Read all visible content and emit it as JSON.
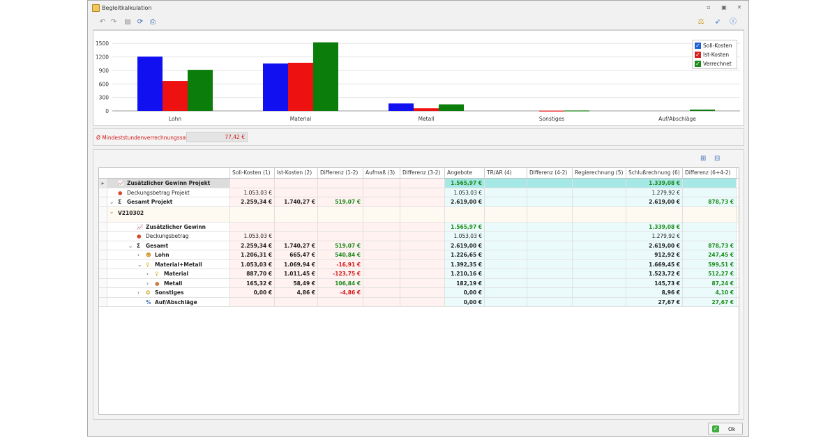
{
  "window": {
    "title": "Begleitkalkulation"
  },
  "legend": [
    {
      "label": "Soll-Kosten",
      "color": "#1010f0"
    },
    {
      "label": "Ist-Kosten",
      "color": "#ee1111"
    },
    {
      "label": "Verrechnet",
      "color": "#0b7d0b"
    }
  ],
  "chart_data": {
    "type": "bar",
    "categories": [
      "Lohn",
      "Material",
      "Metall",
      "Sonstiges",
      "Auf/Abschläge"
    ],
    "series": [
      {
        "name": "Soll-Kosten",
        "values": [
          1206.31,
          1053.03,
          165.32,
          0,
          0
        ]
      },
      {
        "name": "Ist-Kosten",
        "values": [
          665.47,
          1069.94,
          58.49,
          4.86,
          0
        ]
      },
      {
        "name": "Verrechnet",
        "values": [
          912.92,
          1523.72,
          145.73,
          8.96,
          27.67
        ]
      }
    ],
    "yticks": [
      "0",
      "300",
      "600",
      "900",
      "1200",
      "1500"
    ],
    "ylim": [
      0,
      1550
    ],
    "grid": true,
    "legend_position": "top-right"
  },
  "rate": {
    "label": "Ø Mindeststundenverrechnungssatz",
    "value": "77,42 €"
  },
  "columns": [
    "Soll-Kosten (1)",
    "Ist-Kosten (2)",
    "Differenz (1-2)",
    "Aufmaß (3)",
    "Differenz (3-2)",
    "Angebote",
    "TR/AR (4)",
    "Differenz (4-2)",
    "Regierechnung (5)",
    "Schlußrechnung (6)",
    "Differenz (6+4-2)"
  ],
  "rows": [
    {
      "name": "Zusätzlicher Gewinn Projekt",
      "indent": 0,
      "icon": "chart-up",
      "bold": true,
      "exp": "▸",
      "selected": true,
      "c": [
        "",
        "",
        "",
        "",
        "",
        "1.565,97 €",
        "",
        "",
        "",
        "1.339,08 €",
        ""
      ],
      "cls": [
        "",
        "",
        "",
        "",
        "",
        "pos",
        "",
        "",
        "",
        "pos",
        ""
      ]
    },
    {
      "name": "Deckungsbetrag Projekt",
      "indent": 0,
      "icon": "pie",
      "c": [
        "1.053,03 €",
        "",
        "",
        "",
        "",
        "1.053,03 €",
        "",
        "",
        "",
        "1.279,92 €",
        ""
      ],
      "cls": [
        "",
        "",
        "",
        "",
        "",
        "",
        "",
        "",
        "",
        "",
        ""
      ]
    },
    {
      "name": "Gesamt Projekt",
      "indent": 0,
      "icon": "sigma",
      "bold": true,
      "exp": "⌄",
      "c": [
        "2.259,34 €",
        "1.740,27 €",
        "519,07 €",
        "",
        "",
        "2.619,00 €",
        "",
        "",
        "",
        "2.619,00 €",
        "878,73 €"
      ],
      "cls": [
        "",
        "",
        "pos",
        "",
        "",
        "",
        "",
        "",
        "",
        "",
        "pos"
      ]
    },
    {
      "name": "V210302",
      "indent": 0,
      "icon": "none",
      "bold": true,
      "exp": "⌄",
      "group": true,
      "c": [
        "",
        "",
        "",
        "",
        "",
        "",
        "",
        "",
        "",
        "",
        ""
      ],
      "cls": [
        "",
        "",
        "",
        "",
        "",
        "",
        "",
        "",
        "",
        "",
        ""
      ]
    },
    {
      "name": "Zusätzlicher Gewinn",
      "indent": 1,
      "icon": "chart-up",
      "bold": true,
      "c": [
        "",
        "",
        "",
        "",
        "",
        "1.565,97 €",
        "",
        "",
        "",
        "1.339,08 €",
        ""
      ],
      "cls": [
        "",
        "",
        "",
        "",
        "",
        "pos",
        "",
        "",
        "",
        "pos",
        ""
      ]
    },
    {
      "name": "Deckungsbetrag",
      "indent": 1,
      "icon": "pie",
      "c": [
        "1.053,03 €",
        "",
        "",
        "",
        "",
        "1.053,03 €",
        "",
        "",
        "",
        "1.279,92 €",
        ""
      ],
      "cls": [
        "",
        "",
        "",
        "",
        "",
        "",
        "",
        "",
        "",
        "",
        ""
      ]
    },
    {
      "name": "Gesamt",
      "indent": 1,
      "icon": "sigma",
      "bold": true,
      "exp": "⌄",
      "c": [
        "2.259,34 €",
        "1.740,27 €",
        "519,07 €",
        "",
        "",
        "2.619,00 €",
        "",
        "",
        "",
        "2.619,00 €",
        "878,73 €"
      ],
      "cls": [
        "",
        "",
        "pos",
        "",
        "",
        "",
        "",
        "",
        "",
        "",
        "pos"
      ]
    },
    {
      "name": "Lohn",
      "indent": 2,
      "icon": "worker",
      "bold": true,
      "exp": "›",
      "c": [
        "1.206,31 €",
        "665,47 €",
        "540,84 €",
        "",
        "",
        "1.226,65 €",
        "",
        "",
        "",
        "912,92 €",
        "247,45 €"
      ],
      "cls": [
        "",
        "",
        "pos",
        "",
        "",
        "",
        "",
        "",
        "",
        "",
        "pos"
      ]
    },
    {
      "name": "Material+Metall",
      "indent": 2,
      "icon": "bulb",
      "bold": true,
      "exp": "⌄",
      "c": [
        "1.053,03 €",
        "1.069,94 €",
        "-16,91 €",
        "",
        "",
        "1.392,35 €",
        "",
        "",
        "",
        "1.669,45 €",
        "599,51 €"
      ],
      "cls": [
        "",
        "",
        "neg",
        "",
        "",
        "",
        "",
        "",
        "",
        "",
        "pos"
      ]
    },
    {
      "name": "Material",
      "indent": 3,
      "icon": "bulb",
      "bold": true,
      "exp": "›",
      "c": [
        "887,70 €",
        "1.011,45 €",
        "-123,75 €",
        "",
        "",
        "1.210,16 €",
        "",
        "",
        "",
        "1.523,72 €",
        "512,27 €"
      ],
      "cls": [
        "",
        "",
        "neg",
        "",
        "",
        "",
        "",
        "",
        "",
        "",
        "pos"
      ]
    },
    {
      "name": "Metall",
      "indent": 3,
      "icon": "ball",
      "bold": true,
      "exp": "›",
      "c": [
        "165,32 €",
        "58,49 €",
        "106,84 €",
        "",
        "",
        "182,19 €",
        "",
        "",
        "",
        "145,73 €",
        "87,24 €"
      ],
      "cls": [
        "",
        "",
        "pos",
        "",
        "",
        "",
        "",
        "",
        "",
        "",
        "pos"
      ]
    },
    {
      "name": "Sonstiges",
      "indent": 2,
      "icon": "coins",
      "bold": true,
      "exp": "›",
      "c": [
        "0,00 €",
        "4,86 €",
        "-4,86 €",
        "",
        "",
        "0,00 €",
        "",
        "",
        "",
        "8,96 €",
        "4,10 €"
      ],
      "cls": [
        "",
        "",
        "neg",
        "",
        "",
        "",
        "",
        "",
        "",
        "",
        "pos"
      ]
    },
    {
      "name": "Auf/Abschläge",
      "indent": 2,
      "icon": "percent",
      "bold": true,
      "c": [
        "",
        "",
        "",
        "",
        "",
        "0,00 €",
        "",
        "",
        "",
        "27,67 €",
        "27,67 €"
      ],
      "cls": [
        "",
        "",
        "",
        "",
        "",
        "",
        "",
        "",
        "",
        "",
        "pos"
      ]
    }
  ],
  "footer": {
    "ok_label": "Ok"
  }
}
